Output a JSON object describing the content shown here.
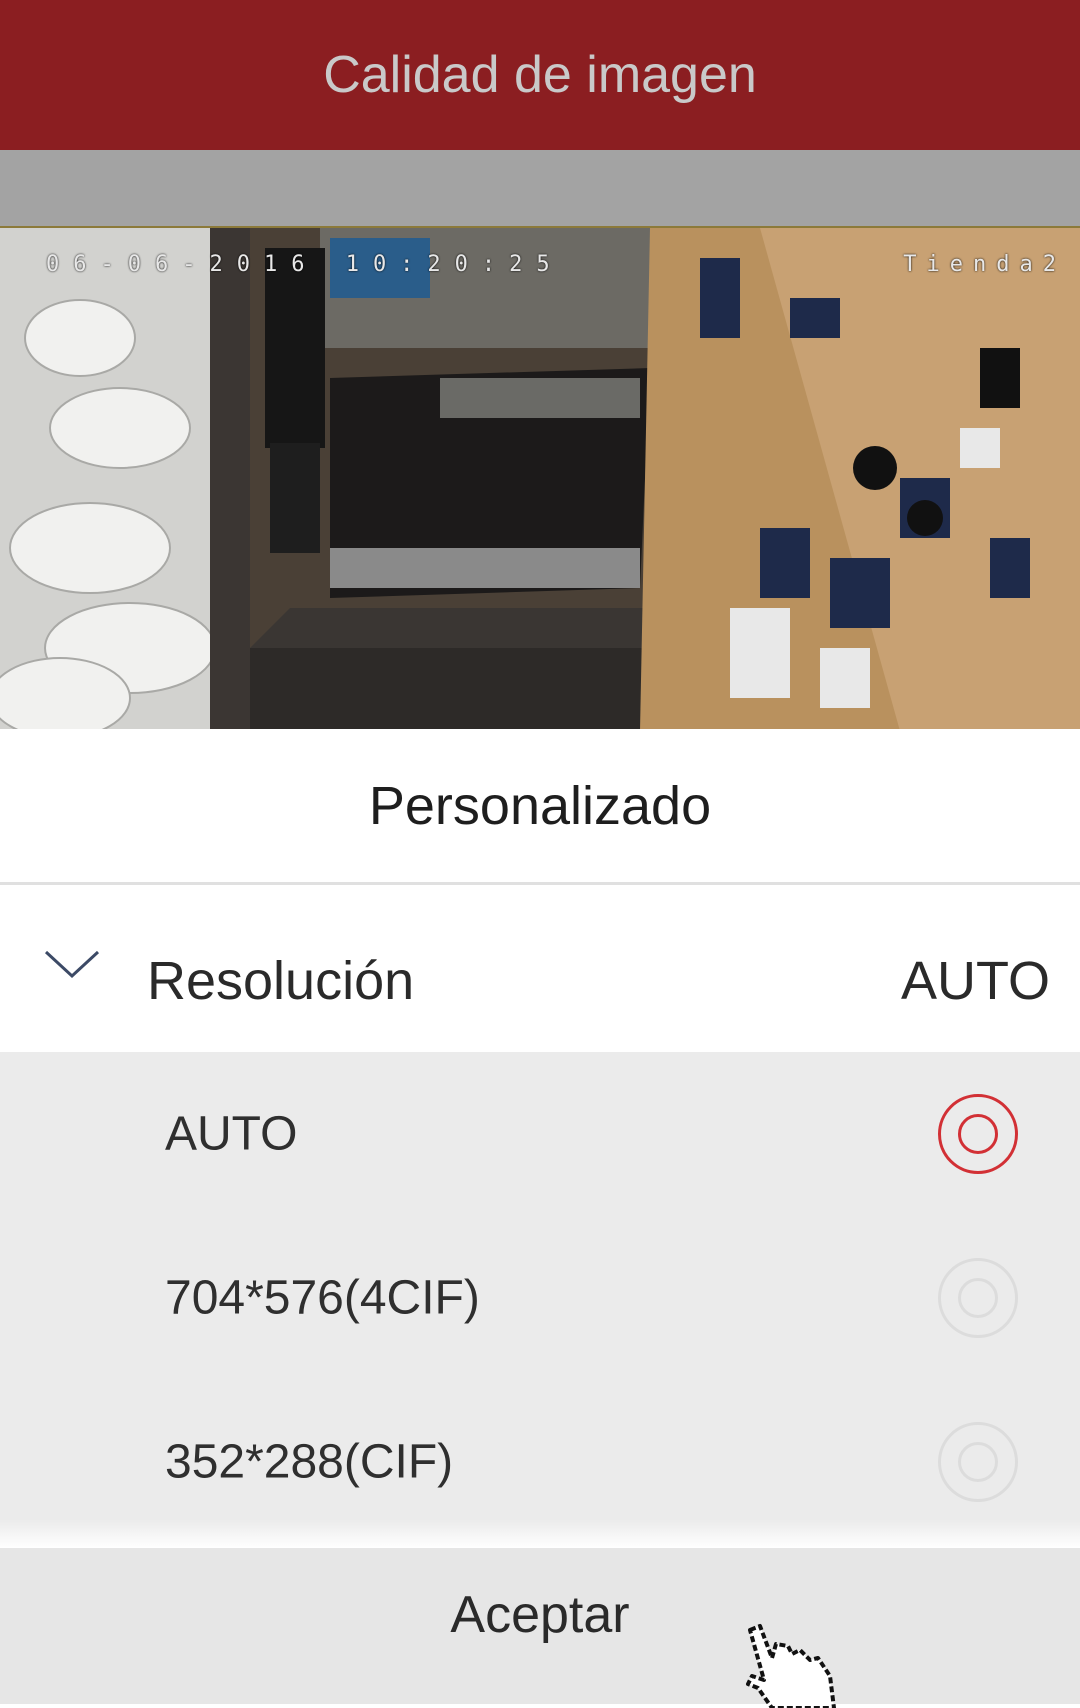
{
  "header": {
    "title": "Calidad de imagen"
  },
  "video": {
    "timestamp": "06-06-2016 10:20:25",
    "camera_name": "Tienda2"
  },
  "preset": {
    "label": "Personalizado"
  },
  "resolution": {
    "label": "Resolución",
    "value": "AUTO",
    "options": [
      {
        "label": "AUTO",
        "selected": true
      },
      {
        "label": "704*576(4CIF)",
        "selected": false
      },
      {
        "label": "352*288(CIF)",
        "selected": false
      }
    ]
  },
  "footer": {
    "accept_label": "Aceptar"
  },
  "colors": {
    "header_bg": "#8b1e21",
    "accent": "#d23035"
  }
}
